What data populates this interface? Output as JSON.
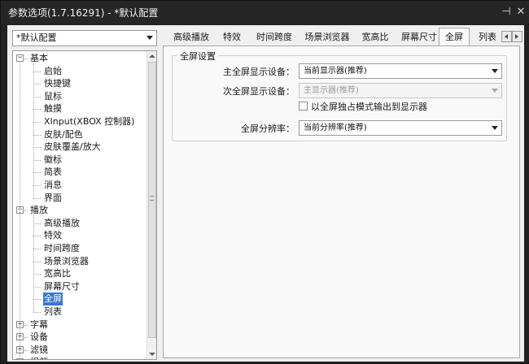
{
  "window": {
    "title": "参数选项(1.7.16291) - *默认配置",
    "pin_glyph": "⊣",
    "close_glyph": "✕"
  },
  "profile": {
    "selected": "*默认配置"
  },
  "tree": {
    "rows": [
      {
        "label": "基本",
        "level": 0,
        "expander": "−"
      },
      {
        "label": "启始",
        "level": 1
      },
      {
        "label": "快捷键",
        "level": 1
      },
      {
        "label": "鼠标",
        "level": 1
      },
      {
        "label": "触摸",
        "level": 1
      },
      {
        "label": "XInput(XBOX 控制器)",
        "level": 1
      },
      {
        "label": "皮肤/配色",
        "level": 1
      },
      {
        "label": "皮肤覆盖/放大",
        "level": 1
      },
      {
        "label": "徽标",
        "level": 1
      },
      {
        "label": "简表",
        "level": 1
      },
      {
        "label": "消息",
        "level": 1
      },
      {
        "label": "界面",
        "level": 1
      },
      {
        "label": "播放",
        "level": 0,
        "expander": "−"
      },
      {
        "label": "高级播放",
        "level": 1
      },
      {
        "label": "特效",
        "level": 1
      },
      {
        "label": "时间跨度",
        "level": 1
      },
      {
        "label": "场景浏览器",
        "level": 1
      },
      {
        "label": "宽高比",
        "level": 1
      },
      {
        "label": "屏幕尺寸",
        "level": 1
      },
      {
        "label": "全屏",
        "level": 1,
        "selected": true
      },
      {
        "label": "列表",
        "level": 1
      },
      {
        "label": "字幕",
        "level": 0,
        "expander": "+"
      },
      {
        "label": "设备",
        "level": 0,
        "expander": "+"
      },
      {
        "label": "滤镜",
        "level": 0,
        "expander": "+"
      },
      {
        "label": "视频",
        "level": 0,
        "expander": "+"
      }
    ]
  },
  "tabs": {
    "items": [
      "高级播放",
      "特效",
      "时间跨度",
      "场景浏览器",
      "宽高比",
      "屏幕尺寸",
      "全屏",
      "列表"
    ],
    "active": "全屏"
  },
  "fullscreen": {
    "group_title": "全屏设置",
    "primary_label": "主全屏显示设备：",
    "primary_value": "当前显示器(推荐)",
    "secondary_label": "次全屏显示设备：",
    "secondary_value": "主显示器(推荐)",
    "exclusive_label": "以全屏独占模式输出到显示器",
    "exclusive_checked": false,
    "resolution_label": "全屏分辨率：",
    "resolution_value": "当前分辨率(推荐)"
  },
  "colors": {
    "selection": "#3875d7",
    "titlebar": "#262626"
  }
}
